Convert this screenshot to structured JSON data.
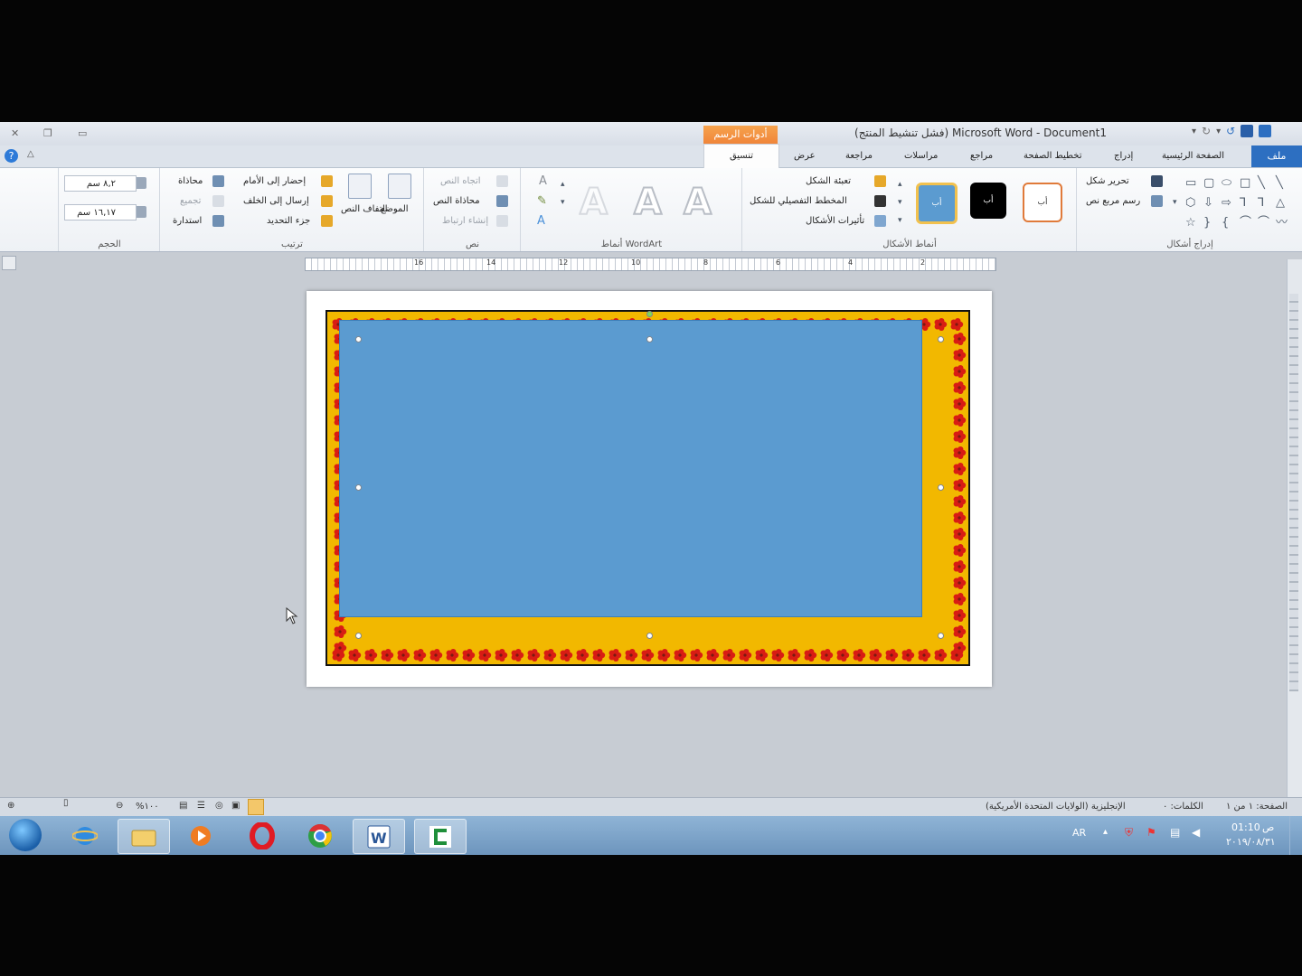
{
  "window": {
    "title": "(فشل تنشيط المنتج) Microsoft Word - Document1",
    "context_tab_group": "أدوات الرسم"
  },
  "tabs": [
    {
      "label": "ملف",
      "active": false
    },
    {
      "label": "الصفحة الرئيسية"
    },
    {
      "label": "إدراج"
    },
    {
      "label": "تخطيط الصفحة"
    },
    {
      "label": "مراجع"
    },
    {
      "label": "مراسلات"
    },
    {
      "label": "مراجعة"
    },
    {
      "label": "عرض"
    },
    {
      "label": "تنسيق",
      "active": true
    }
  ],
  "ribbon": {
    "insert_shapes": {
      "label": "إدراج أشكال",
      "edit_shape": "تحرير شكل",
      "draw_textbox": "رسم مربع نص"
    },
    "shape_styles": {
      "label": "أنماط الأشكال",
      "thumb_text": "أب",
      "fill": "تعبئة الشكل",
      "outline": "المخطط التفصيلي للشكل",
      "effects": "تأثيرات الأشكال"
    },
    "wordart_styles": {
      "label": "أنماط WordArt",
      "glyph": "A"
    },
    "text": {
      "label": "نص",
      "direction": "اتجاه النص",
      "align": "محاذاة النص",
      "link": "إنشاء ارتباط"
    },
    "arrange": {
      "label": "ترتيب",
      "position": "الموضع",
      "wrap": "التفاف النص",
      "bring_forward": "إحضار إلى الأمام",
      "send_backward": "إرسال إلى الخلف",
      "selection_pane": "جزء التحديد",
      "align": "محاذاة",
      "group": "تجميع",
      "rotate": "استدارة"
    },
    "size": {
      "label": "الحجم",
      "height": "٨,٢ سم",
      "width": "١٦,١٧ سم"
    }
  },
  "ruler_numbers": [
    "2",
    "4",
    "6",
    "8",
    "10",
    "12",
    "14",
    "16"
  ],
  "statusbar": {
    "page": "الصفحة: ١ من ١",
    "words": "الكلمات: ٠",
    "language": "الإنجليزية (الولايات المتحدة الأمريكية)",
    "zoom": "%١٠٠"
  },
  "taskbar": {
    "language": "AR",
    "time": "01:10",
    "ampm": "ص",
    "date": "٢٠١٩/٠٨/٣١"
  },
  "colors": {
    "frame_fill": "#f2b800",
    "shape_fill": "#5b9bd0",
    "flower": "#d81c14"
  }
}
